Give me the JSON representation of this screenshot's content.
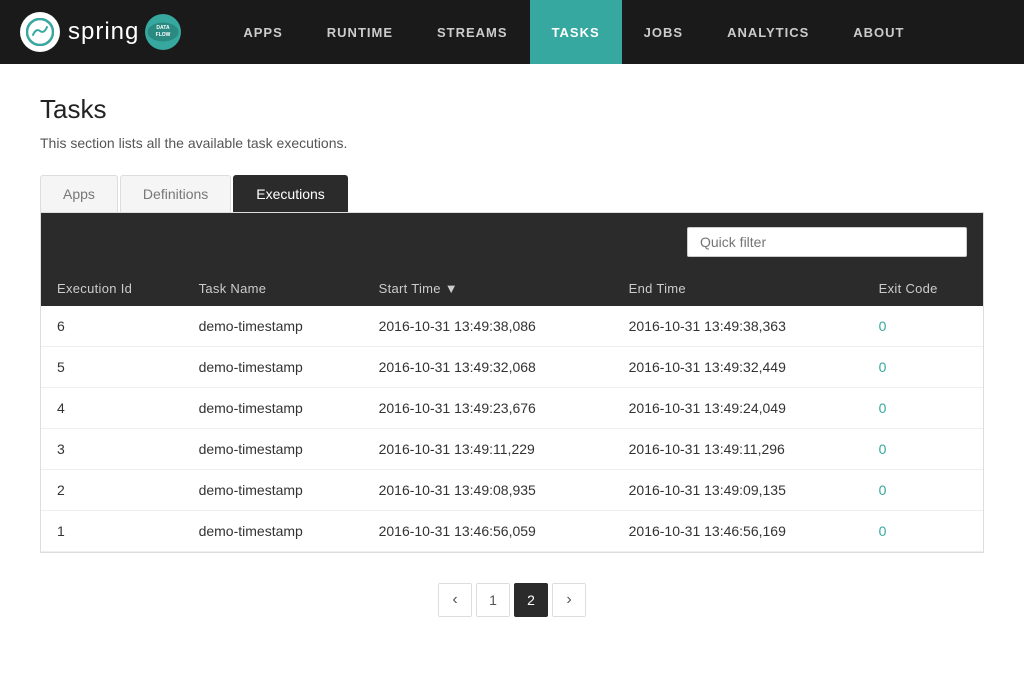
{
  "nav": {
    "logo_text": "spring",
    "logo_badge": "DATAFLOW",
    "links": [
      {
        "label": "APPS",
        "active": false
      },
      {
        "label": "RUNTIME",
        "active": false
      },
      {
        "label": "STREAMS",
        "active": false
      },
      {
        "label": "TASKS",
        "active": true
      },
      {
        "label": "JOBS",
        "active": false
      },
      {
        "label": "ANALYTICS",
        "active": false
      },
      {
        "label": "ABOUT",
        "active": false
      }
    ]
  },
  "page": {
    "title": "Tasks",
    "description": "This section lists all the available task executions."
  },
  "tabs": [
    {
      "label": "Apps",
      "active": false
    },
    {
      "label": "Definitions",
      "active": false
    },
    {
      "label": "Executions",
      "active": true
    }
  ],
  "toolbar": {
    "quick_filter_placeholder": "Quick filter"
  },
  "table": {
    "columns": [
      {
        "label": "Execution Id",
        "sortable": false
      },
      {
        "label": "Task Name",
        "sortable": false
      },
      {
        "label": "Start Time",
        "sortable": true,
        "sort_dir": "desc"
      },
      {
        "label": "End Time",
        "sortable": false
      },
      {
        "label": "Exit Code",
        "sortable": false
      }
    ],
    "rows": [
      {
        "execution_id": "6",
        "task_name": "demo-timestamp",
        "start_time": "2016-10-31 13:49:38,086",
        "end_time": "2016-10-31 13:49:38,363",
        "exit_code": "0"
      },
      {
        "execution_id": "5",
        "task_name": "demo-timestamp",
        "start_time": "2016-10-31 13:49:32,068",
        "end_time": "2016-10-31 13:49:32,449",
        "exit_code": "0"
      },
      {
        "execution_id": "4",
        "task_name": "demo-timestamp",
        "start_time": "2016-10-31 13:49:23,676",
        "end_time": "2016-10-31 13:49:24,049",
        "exit_code": "0"
      },
      {
        "execution_id": "3",
        "task_name": "demo-timestamp",
        "start_time": "2016-10-31 13:49:11,229",
        "end_time": "2016-10-31 13:49:11,296",
        "exit_code": "0"
      },
      {
        "execution_id": "2",
        "task_name": "demo-timestamp",
        "start_time": "2016-10-31 13:49:08,935",
        "end_time": "2016-10-31 13:49:09,135",
        "exit_code": "0"
      },
      {
        "execution_id": "1",
        "task_name": "demo-timestamp",
        "start_time": "2016-10-31 13:46:56,059",
        "end_time": "2016-10-31 13:46:56,169",
        "exit_code": "0"
      }
    ]
  },
  "pagination": {
    "prev_label": "‹",
    "next_label": "›",
    "pages": [
      "1",
      "2"
    ],
    "active_page": "2"
  }
}
